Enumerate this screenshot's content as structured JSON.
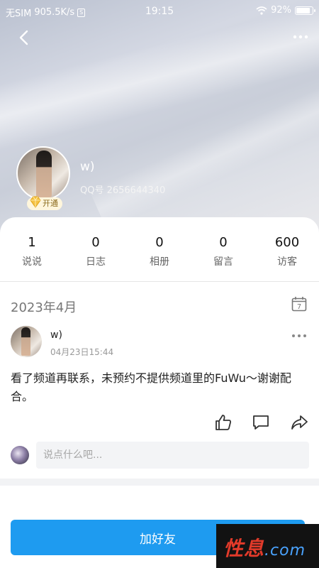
{
  "status_bar": {
    "carrier": "无SIM",
    "speed": "905.5K/s",
    "time": "19:15",
    "battery": "92%",
    "battery_level": 0.92
  },
  "profile": {
    "name": "w)",
    "qq_number": "QQ号 2656644340",
    "vip_label": "开通"
  },
  "stats": [
    {
      "value": "1",
      "label": "说说"
    },
    {
      "value": "0",
      "label": "日志"
    },
    {
      "value": "0",
      "label": "相册"
    },
    {
      "value": "0",
      "label": "留言"
    },
    {
      "value": "600",
      "label": "访客"
    }
  ],
  "calendar": {
    "day": "7"
  },
  "timeline": {
    "month": "2023年4月"
  },
  "post": {
    "author": "w)",
    "time": "04月23日15:44",
    "content": "看了频道再联系，未预约不提供频道里的FuWu～谢谢配合。"
  },
  "comment": {
    "placeholder": "说点什么吧..."
  },
  "actions": {
    "add_friend": "加好友"
  },
  "watermark": {
    "text": "性息",
    "domain": ".com"
  },
  "colors": {
    "accent": "#1e9bf0",
    "vip": "#f5c242"
  }
}
